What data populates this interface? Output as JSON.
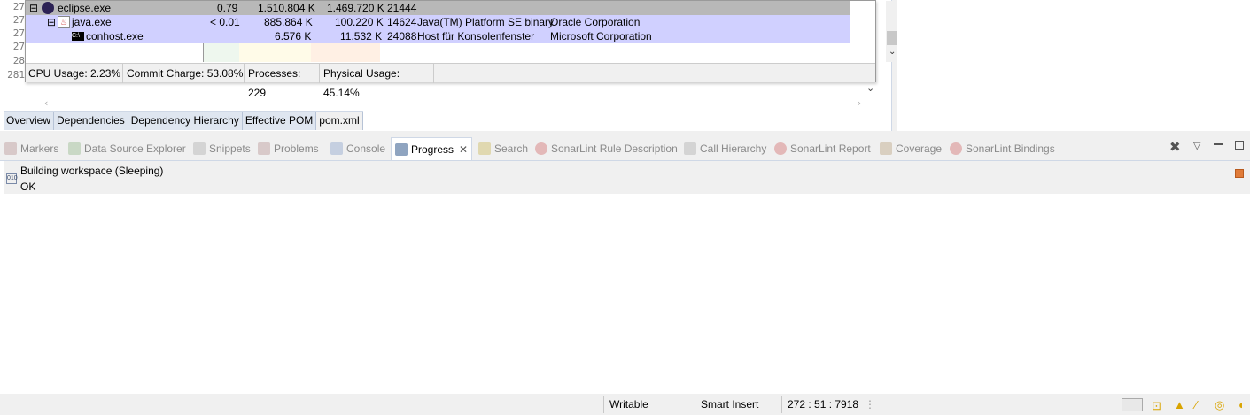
{
  "editor": {
    "line_numbers": [
      "27",
      "27",
      "27",
      "27",
      "28",
      "281"
    ],
    "tabs": [
      "Overview",
      "Dependencies",
      "Dependency Hierarchy",
      "Effective POM",
      "pom.xml"
    ]
  },
  "process_explorer": {
    "rows": [
      {
        "name": "eclipse.exe",
        "cpu": "0.79",
        "private_bytes": "1.510.804 K",
        "working_set": "1.469.720 K",
        "pid": "21444",
        "description": "",
        "company": ""
      },
      {
        "name": "java.exe",
        "cpu": "< 0.01",
        "private_bytes": "885.864 K",
        "working_set": "100.220 K",
        "pid": "14624",
        "description": "Java(TM) Platform SE binary",
        "company": "Oracle Corporation"
      },
      {
        "name": "conhost.exe",
        "cpu": "",
        "private_bytes": "6.576 K",
        "working_set": "11.532 K",
        "pid": "24088",
        "description": "Host für Konsolenfenster",
        "company": "Microsoft Corporation"
      }
    ],
    "status": {
      "cpu": "CPU Usage: 2.23%",
      "commit": "Commit Charge: 53.08%",
      "processes": "Processes: 229",
      "physical": "Physical Usage: 45.14%"
    },
    "colors": {
      "selected_row": "#b8b8b8",
      "service_row": "#d0d0ff"
    }
  },
  "view_tabs": [
    {
      "label": "Markers",
      "icon": "markers-icon"
    },
    {
      "label": "Data Source Explorer",
      "icon": "data-source-icon"
    },
    {
      "label": "Snippets",
      "icon": "snippets-icon"
    },
    {
      "label": "Problems",
      "icon": "problems-icon"
    },
    {
      "label": "Console",
      "icon": "console-icon"
    },
    {
      "label": "Progress",
      "icon": "progress-icon",
      "active": true
    },
    {
      "label": "Search",
      "icon": "search-icon"
    },
    {
      "label": "SonarLint Rule Description",
      "icon": "sonarlint-icon"
    },
    {
      "label": "Call Hierarchy",
      "icon": "call-hierarchy-icon"
    },
    {
      "label": "SonarLint Report",
      "icon": "sonarlint-report-icon"
    },
    {
      "label": "Coverage",
      "icon": "coverage-icon"
    },
    {
      "label": "SonarLint Bindings",
      "icon": "sonarlint-bindings-icon"
    }
  ],
  "progress": {
    "job_title": "Building workspace (Sleeping)",
    "job_status": "OK"
  },
  "statusbar": {
    "writable": "Writable",
    "insert_mode": "Smart Insert",
    "position": "272 : 51 : 7918"
  }
}
